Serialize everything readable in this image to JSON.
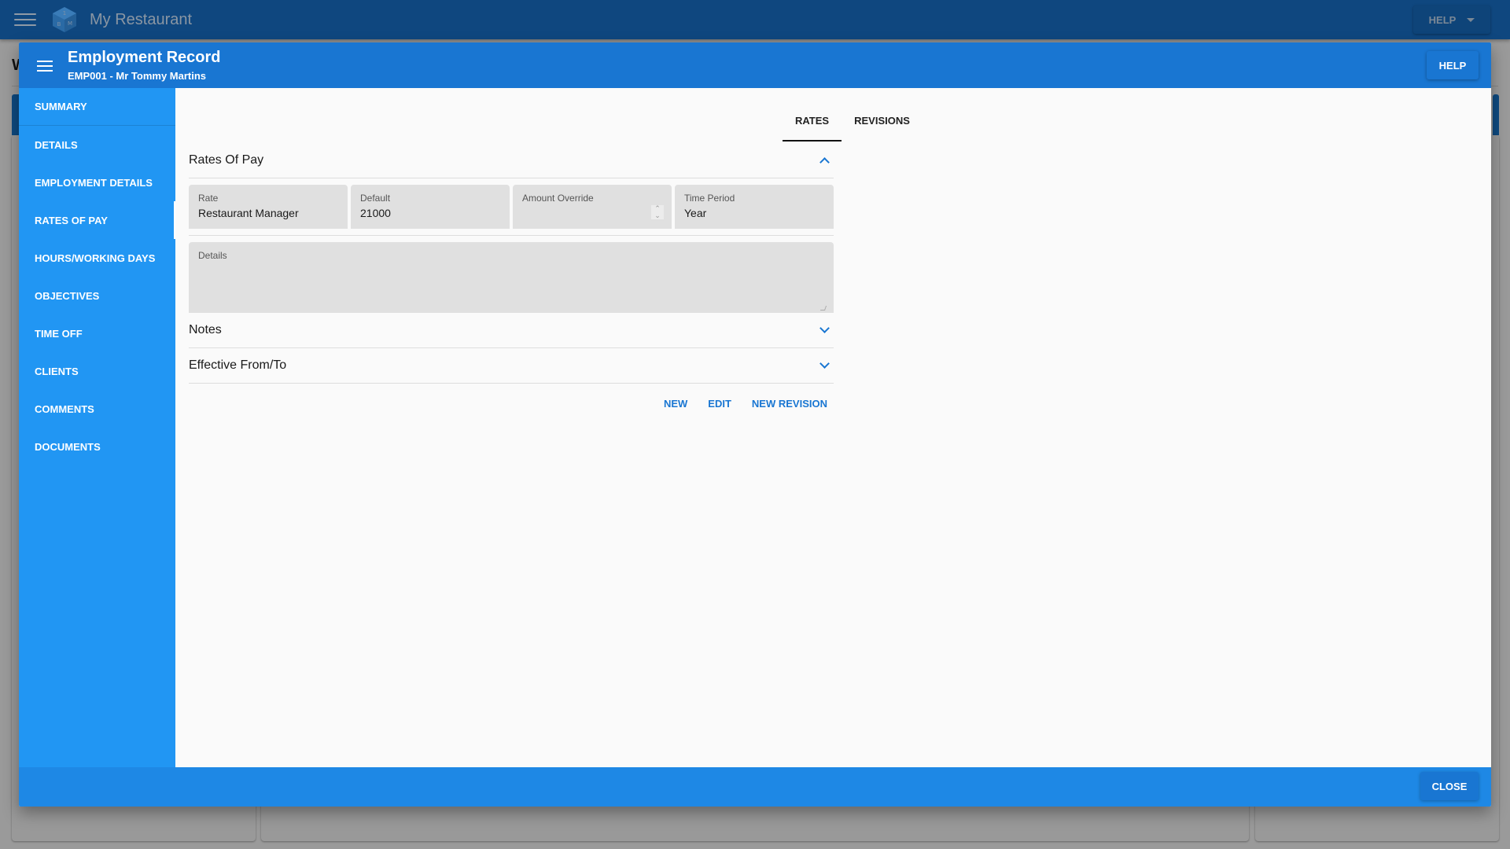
{
  "app": {
    "title": "My Restaurant",
    "help_label": "HELP",
    "menu_icon": "hamburger-menu-icon",
    "logo_icon": "cube-logo-icon",
    "logo_letters": [
      "1",
      "B",
      "M"
    ],
    "background_heading_fragment": "W"
  },
  "modal": {
    "title": "Employment Record",
    "subtitle": "EMP001 - Mr Tommy Martins",
    "help_label": "HELP",
    "close_label": "CLOSE"
  },
  "sidebar": {
    "items": [
      {
        "label": "SUMMARY",
        "active": false
      },
      {
        "label": "DETAILS",
        "active": false
      },
      {
        "label": "EMPLOYMENT DETAILS",
        "active": false
      },
      {
        "label": "RATES OF PAY",
        "active": true
      },
      {
        "label": "HOURS/WORKING DAYS",
        "active": false
      },
      {
        "label": "OBJECTIVES",
        "active": false
      },
      {
        "label": "TIME OFF",
        "active": false
      },
      {
        "label": "CLIENTS",
        "active": false
      },
      {
        "label": "COMMENTS",
        "active": false
      },
      {
        "label": "DOCUMENTS",
        "active": false
      }
    ]
  },
  "tabs": [
    {
      "label": "RATES",
      "active": true
    },
    {
      "label": "REVISIONS",
      "active": false
    }
  ],
  "rates_section": {
    "title": "Rates Of Pay",
    "expanded": true,
    "fields": {
      "rate": {
        "label": "Rate",
        "value": "Restaurant Manager"
      },
      "default": {
        "label": "Default",
        "value": "21000"
      },
      "amount_override": {
        "label": "Amount Override",
        "value": ""
      },
      "time_period": {
        "label": "Time Period",
        "value": "Year"
      }
    },
    "details": {
      "label": "Details",
      "value": ""
    }
  },
  "notes_section": {
    "title": "Notes",
    "expanded": false
  },
  "effective_section": {
    "title": "Effective From/To",
    "expanded": false
  },
  "actions": {
    "new_label": "NEW",
    "edit_label": "EDIT",
    "new_revision_label": "NEW REVISION"
  },
  "colors": {
    "header_blue": "#1976d2",
    "sidebar_blue": "#2196f3",
    "footer_blue": "#1e88e5",
    "accent": "#1976d2"
  }
}
